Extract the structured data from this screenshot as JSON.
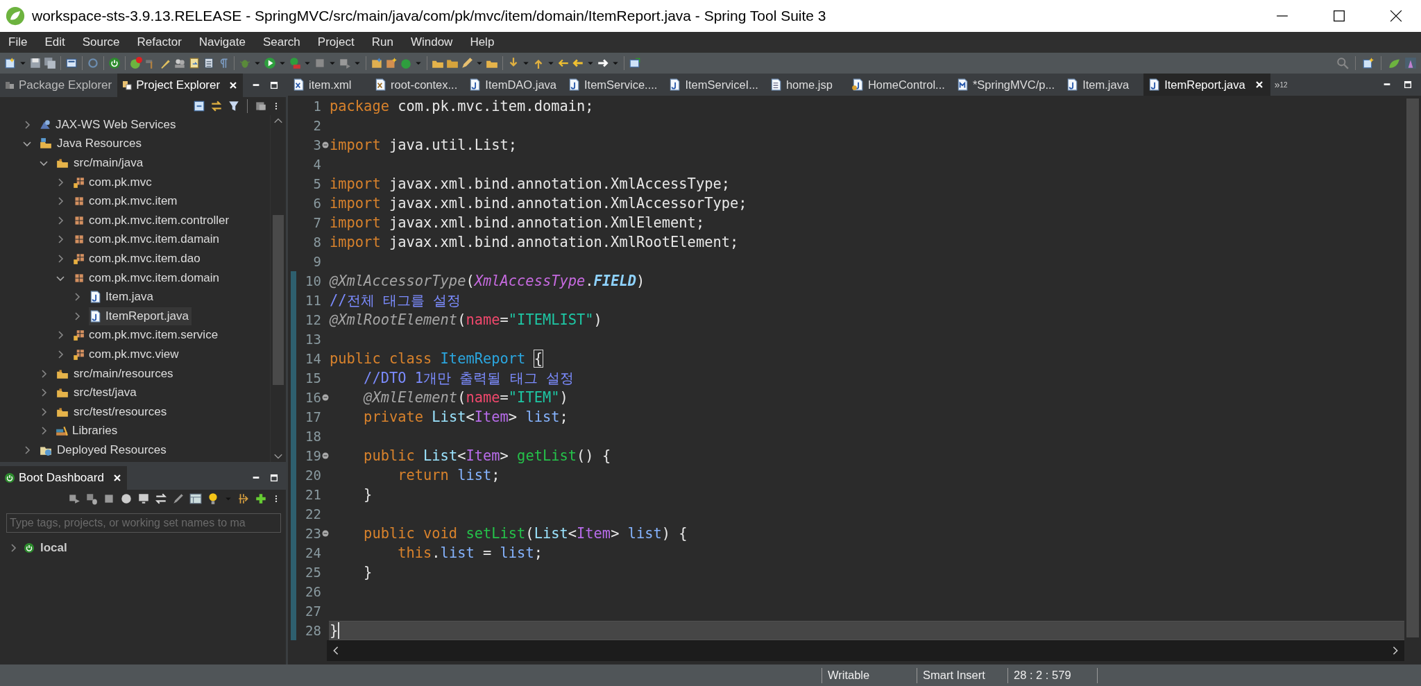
{
  "window": {
    "title": "workspace-sts-3.9.13.RELEASE - SpringMVC/src/main/java/com/pk/mvc/item/domain/ItemReport.java - Spring Tool Suite 3"
  },
  "menu": [
    "File",
    "Edit",
    "Source",
    "Refactor",
    "Navigate",
    "Search",
    "Project",
    "Run",
    "Window",
    "Help"
  ],
  "project_explorer": {
    "tabs": [
      {
        "label": "Package Explorer",
        "selected": false
      },
      {
        "label": "Project Explorer",
        "selected": true
      }
    ],
    "tree": [
      {
        "label": "JAX-WS Web Services",
        "kind": "services",
        "expanded": false,
        "selected": false
      },
      {
        "label": "Java Resources",
        "kind": "resources",
        "expanded": true,
        "selected": false,
        "children": [
          {
            "label": "src/main/java",
            "kind": "folder",
            "expanded": true,
            "selected": false,
            "children": [
              {
                "label": "com.pk.mvc",
                "kind": "decorated",
                "expanded": false,
                "selected": false
              },
              {
                "label": "com.pk.mvc.item",
                "kind": "package",
                "expanded": false,
                "selected": false
              },
              {
                "label": "com.pk.mvc.item.controller",
                "kind": "package",
                "expanded": false,
                "selected": false
              },
              {
                "label": "com.pk.mvc.item.damain",
                "kind": "package",
                "expanded": false,
                "selected": false
              },
              {
                "label": "com.pk.mvc.item.dao",
                "kind": "decorated",
                "expanded": false,
                "selected": false
              },
              {
                "label": "com.pk.mvc.item.domain",
                "kind": "package",
                "expanded": true,
                "selected": false,
                "children": [
                  {
                    "label": "Item.java",
                    "kind": "file",
                    "expanded": false,
                    "selected": false
                  },
                  {
                    "label": "ItemReport.java",
                    "kind": "file",
                    "expanded": false,
                    "selected": true
                  }
                ]
              },
              {
                "label": "com.pk.mvc.item.service",
                "kind": "decorated",
                "expanded": false,
                "selected": false
              },
              {
                "label": "com.pk.mvc.view",
                "kind": "decorated",
                "expanded": false,
                "selected": false
              }
            ]
          },
          {
            "label": "src/main/resources",
            "kind": "folder",
            "expanded": false,
            "selected": false
          },
          {
            "label": "src/test/java",
            "kind": "folder",
            "expanded": false,
            "selected": false
          },
          {
            "label": "src/test/resources",
            "kind": "folder",
            "expanded": false,
            "selected": false
          },
          {
            "label": "Libraries",
            "kind": "libraries",
            "expanded": false,
            "selected": false
          }
        ]
      },
      {
        "label": "Deployed Resources",
        "kind": "deployed",
        "expanded": false,
        "selected": false
      }
    ]
  },
  "boot_dashboard": {
    "title": "Boot Dashboard",
    "filter": {
      "placeholder": "Type tags, projects, or working set names to ma"
    },
    "items": [
      {
        "label": "local",
        "expanded": false
      }
    ]
  },
  "editor": {
    "tabs": [
      {
        "label": "item.xml",
        "kind": "xml",
        "selected": false
      },
      {
        "label": "root-contex...",
        "kind": "beans",
        "selected": false
      },
      {
        "label": "ItemDAO.java",
        "kind": "java",
        "selected": false
      },
      {
        "label": "ItemService....",
        "kind": "java",
        "selected": false
      },
      {
        "label": "ItemServiceI...",
        "kind": "java",
        "selected": false
      },
      {
        "label": "home.jsp",
        "kind": "jsp",
        "selected": false
      },
      {
        "label": "HomeControl...",
        "kind": "controller",
        "selected": false
      },
      {
        "label": "*SpringMVC/p...",
        "kind": "maven",
        "selected": false
      },
      {
        "label": "Item.java",
        "kind": "java",
        "selected": false
      },
      {
        "label": "ItemReport.java",
        "kind": "java",
        "selected": true
      }
    ],
    "overflow": {
      "marker": "»",
      "count": "12"
    },
    "lines": [
      {
        "number": "1",
        "fold": false,
        "changed": false,
        "current": false,
        "tokens": [
          {
            "text": "package ",
            "kind": "kw"
          },
          {
            "text": "com.pk.mvc.item.domain;",
            "kind": "plain"
          }
        ]
      },
      {
        "number": "2",
        "fold": false,
        "changed": false,
        "current": false
      },
      {
        "number": "3",
        "fold": true,
        "changed": false,
        "current": false,
        "tokens": [
          {
            "text": "import ",
            "kind": "kw"
          },
          {
            "text": "java.util.List;",
            "kind": "plain"
          }
        ]
      },
      {
        "number": "4",
        "fold": false,
        "changed": false,
        "current": false
      },
      {
        "number": "5",
        "fold": false,
        "changed": false,
        "current": false,
        "tokens": [
          {
            "text": "import ",
            "kind": "kw"
          },
          {
            "text": "javax.xml.bind.annotation.XmlAccessType;",
            "kind": "plain"
          }
        ]
      },
      {
        "number": "6",
        "fold": false,
        "changed": false,
        "current": false,
        "tokens": [
          {
            "text": "import ",
            "kind": "kw"
          },
          {
            "text": "javax.xml.bind.annotation.XmlAccessorType;",
            "kind": "plain"
          }
        ]
      },
      {
        "number": "7",
        "fold": false,
        "changed": false,
        "current": false,
        "tokens": [
          {
            "text": "import ",
            "kind": "kw"
          },
          {
            "text": "javax.xml.bind.annotation.XmlElement;",
            "kind": "plain"
          }
        ]
      },
      {
        "number": "8",
        "fold": false,
        "changed": false,
        "current": false,
        "tokens": [
          {
            "text": "import ",
            "kind": "kw"
          },
          {
            "text": "javax.xml.bind.annotation.XmlRootElement;",
            "kind": "plain"
          }
        ]
      },
      {
        "number": "9",
        "fold": false,
        "changed": false,
        "current": false
      },
      {
        "number": "10",
        "fold": false,
        "changed": true,
        "current": false,
        "tokens": [
          {
            "text": "@XmlAccessorType",
            "kind": "ann"
          },
          {
            "text": "(",
            "kind": "plain"
          },
          {
            "text": "XmlAccessType",
            "kind": "enum"
          },
          {
            "text": ".",
            "kind": "plain"
          },
          {
            "text": "FIELD",
            "kind": "const"
          },
          {
            "text": ")",
            "kind": "plain"
          }
        ]
      },
      {
        "number": "11",
        "fold": false,
        "changed": true,
        "current": false,
        "tokens": [
          {
            "text": "//전체 태그를 설정",
            "kind": "comment"
          }
        ]
      },
      {
        "number": "12",
        "fold": false,
        "changed": true,
        "current": false,
        "tokens": [
          {
            "text": "@XmlRootElement",
            "kind": "ann"
          },
          {
            "text": "(",
            "kind": "plain"
          },
          {
            "text": "name",
            "kind": "attr"
          },
          {
            "text": "=",
            "kind": "plain"
          },
          {
            "text": "\"ITEMLIST\"",
            "kind": "str"
          },
          {
            "text": ")",
            "kind": "plain"
          }
        ]
      },
      {
        "number": "13",
        "fold": false,
        "changed": true,
        "current": false
      },
      {
        "number": "14",
        "fold": false,
        "changed": true,
        "current": false,
        "tokens": [
          {
            "text": "public class ",
            "kind": "kw"
          },
          {
            "text": "ItemReport ",
            "kind": "cls"
          },
          {
            "text": "{",
            "kind": "brace"
          }
        ]
      },
      {
        "number": "15",
        "fold": false,
        "changed": true,
        "current": false,
        "tokens": [
          {
            "text": "    //DTO 1개만 출력될 태그 설정",
            "kind": "comment"
          }
        ]
      },
      {
        "number": "16",
        "fold": true,
        "changed": true,
        "current": false,
        "tokens": [
          {
            "text": "    @XmlElement",
            "kind": "ann"
          },
          {
            "text": "(",
            "kind": "plain"
          },
          {
            "text": "name",
            "kind": "attr"
          },
          {
            "text": "=",
            "kind": "plain"
          },
          {
            "text": "\"ITEM\"",
            "kind": "str"
          },
          {
            "text": ")",
            "kind": "plain"
          }
        ]
      },
      {
        "number": "17",
        "fold": false,
        "changed": true,
        "current": false,
        "tokens": [
          {
            "text": "    private ",
            "kind": "kw"
          },
          {
            "text": "List",
            "kind": "type"
          },
          {
            "text": "<",
            "kind": "plain"
          },
          {
            "text": "Item",
            "kind": "generic"
          },
          {
            "text": "> ",
            "kind": "plain"
          },
          {
            "text": "list",
            "kind": "var"
          },
          {
            "text": ";",
            "kind": "plain"
          }
        ]
      },
      {
        "number": "18",
        "fold": false,
        "changed": true,
        "current": false
      },
      {
        "number": "19",
        "fold": true,
        "changed": true,
        "current": false,
        "tokens": [
          {
            "text": "    public ",
            "kind": "kw"
          },
          {
            "text": "List",
            "kind": "type"
          },
          {
            "text": "<",
            "kind": "plain"
          },
          {
            "text": "Item",
            "kind": "generic"
          },
          {
            "text": "> ",
            "kind": "plain"
          },
          {
            "text": "getList",
            "kind": "method"
          },
          {
            "text": "() {",
            "kind": "plain"
          }
        ]
      },
      {
        "number": "20",
        "fold": false,
        "changed": true,
        "current": false,
        "tokens": [
          {
            "text": "        return ",
            "kind": "kw"
          },
          {
            "text": "list",
            "kind": "var"
          },
          {
            "text": ";",
            "kind": "plain"
          }
        ]
      },
      {
        "number": "21",
        "fold": false,
        "changed": true,
        "current": false,
        "tokens": [
          {
            "text": "    }",
            "kind": "plain"
          }
        ]
      },
      {
        "number": "22",
        "fold": false,
        "changed": true,
        "current": false
      },
      {
        "number": "23",
        "fold": true,
        "changed": true,
        "current": false,
        "tokens": [
          {
            "text": "    public void ",
            "kind": "kw"
          },
          {
            "text": "setList",
            "kind": "method"
          },
          {
            "text": "(",
            "kind": "plain"
          },
          {
            "text": "List",
            "kind": "type"
          },
          {
            "text": "<",
            "kind": "plain"
          },
          {
            "text": "Item",
            "kind": "generic"
          },
          {
            "text": "> ",
            "kind": "plain"
          },
          {
            "text": "list",
            "kind": "var"
          },
          {
            "text": ") {",
            "kind": "plain"
          }
        ]
      },
      {
        "number": "24",
        "fold": false,
        "changed": true,
        "current": false,
        "tokens": [
          {
            "text": "        this",
            "kind": "kw"
          },
          {
            "text": ".",
            "kind": "plain"
          },
          {
            "text": "list",
            "kind": "var"
          },
          {
            "text": " = ",
            "kind": "plain"
          },
          {
            "text": "list",
            "kind": "var"
          },
          {
            "text": ";",
            "kind": "plain"
          }
        ]
      },
      {
        "number": "25",
        "fold": false,
        "changed": true,
        "current": false,
        "tokens": [
          {
            "text": "    }",
            "kind": "plain"
          }
        ]
      },
      {
        "number": "26",
        "fold": false,
        "changed": true,
        "current": false
      },
      {
        "number": "27",
        "fold": false,
        "changed": true,
        "current": false
      },
      {
        "number": "28",
        "fold": false,
        "changed": true,
        "current": true,
        "tokens": [
          {
            "text": "}",
            "kind": "plain"
          }
        ]
      }
    ]
  },
  "status_bar": [
    "Writable",
    "Smart Insert",
    "28 : 2 : 579"
  ]
}
